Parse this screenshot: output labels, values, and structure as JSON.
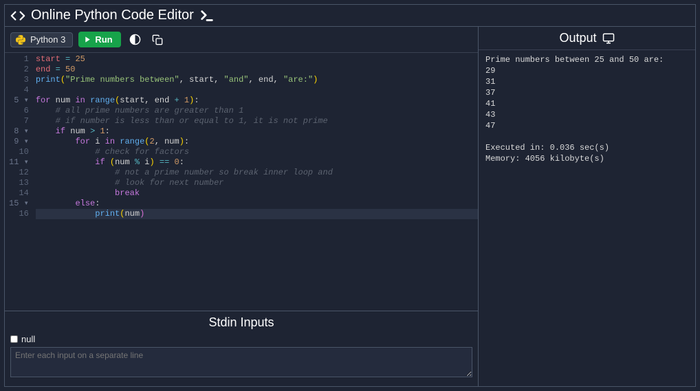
{
  "header": {
    "title": "Online Python Code Editor"
  },
  "toolbar": {
    "language": "Python 3",
    "run_label": "Run"
  },
  "editor": {
    "lines": [
      {
        "n": 1,
        "fold": false,
        "tokens": [
          {
            "t": "start",
            "c": "var"
          },
          {
            "t": " "
          },
          {
            "t": "=",
            "c": "op"
          },
          {
            "t": " "
          },
          {
            "t": "25",
            "c": "num"
          }
        ]
      },
      {
        "n": 2,
        "fold": false,
        "tokens": [
          {
            "t": "end",
            "c": "var"
          },
          {
            "t": " "
          },
          {
            "t": "=",
            "c": "op"
          },
          {
            "t": " "
          },
          {
            "t": "50",
            "c": "num"
          }
        ]
      },
      {
        "n": 3,
        "fold": false,
        "tokens": [
          {
            "t": "print",
            "c": "fn"
          },
          {
            "t": "(",
            "c": "par"
          },
          {
            "t": "\"Prime numbers between\"",
            "c": "str"
          },
          {
            "t": ", start, "
          },
          {
            "t": "\"and\"",
            "c": "str"
          },
          {
            "t": ", end, "
          },
          {
            "t": "\"are:\"",
            "c": "str"
          },
          {
            "t": ")",
            "c": "par"
          }
        ]
      },
      {
        "n": 4,
        "fold": false,
        "tokens": []
      },
      {
        "n": 5,
        "fold": true,
        "tokens": [
          {
            "t": "for",
            "c": "kw"
          },
          {
            "t": " num "
          },
          {
            "t": "in",
            "c": "kw"
          },
          {
            "t": " "
          },
          {
            "t": "range",
            "c": "fn"
          },
          {
            "t": "(",
            "c": "par"
          },
          {
            "t": "start, end "
          },
          {
            "t": "+",
            "c": "op"
          },
          {
            "t": " "
          },
          {
            "t": "1",
            "c": "num"
          },
          {
            "t": ")",
            "c": "par"
          },
          {
            "t": ":"
          }
        ]
      },
      {
        "n": 6,
        "fold": false,
        "tokens": [
          {
            "t": "    "
          },
          {
            "t": "# all prime numbers are greater than 1",
            "c": "cm"
          }
        ]
      },
      {
        "n": 7,
        "fold": false,
        "tokens": [
          {
            "t": "    "
          },
          {
            "t": "# if number is less than or equal to 1, it is not prime",
            "c": "cm"
          }
        ]
      },
      {
        "n": 8,
        "fold": true,
        "tokens": [
          {
            "t": "    "
          },
          {
            "t": "if",
            "c": "kw"
          },
          {
            "t": " num "
          },
          {
            "t": ">",
            "c": "op"
          },
          {
            "t": " "
          },
          {
            "t": "1",
            "c": "num"
          },
          {
            "t": ":"
          }
        ]
      },
      {
        "n": 9,
        "fold": true,
        "tokens": [
          {
            "t": "        "
          },
          {
            "t": "for",
            "c": "kw"
          },
          {
            "t": " i "
          },
          {
            "t": "in",
            "c": "kw"
          },
          {
            "t": " "
          },
          {
            "t": "range",
            "c": "fn"
          },
          {
            "t": "(",
            "c": "par"
          },
          {
            "t": "2",
            "c": "num"
          },
          {
            "t": ", num"
          },
          {
            "t": ")",
            "c": "par"
          },
          {
            "t": ":"
          }
        ]
      },
      {
        "n": 10,
        "fold": false,
        "tokens": [
          {
            "t": "            "
          },
          {
            "t": "# check for factors",
            "c": "cm"
          }
        ]
      },
      {
        "n": 11,
        "fold": true,
        "tokens": [
          {
            "t": "            "
          },
          {
            "t": "if",
            "c": "kw"
          },
          {
            "t": " "
          },
          {
            "t": "(",
            "c": "par"
          },
          {
            "t": "num "
          },
          {
            "t": "%",
            "c": "op"
          },
          {
            "t": " i"
          },
          {
            "t": ")",
            "c": "par"
          },
          {
            "t": " "
          },
          {
            "t": "==",
            "c": "op"
          },
          {
            "t": " "
          },
          {
            "t": "0",
            "c": "num"
          },
          {
            "t": ":"
          }
        ]
      },
      {
        "n": 12,
        "fold": false,
        "tokens": [
          {
            "t": "                "
          },
          {
            "t": "# not a prime number so break inner loop and",
            "c": "cm"
          }
        ]
      },
      {
        "n": 13,
        "fold": false,
        "tokens": [
          {
            "t": "                "
          },
          {
            "t": "# look for next number",
            "c": "cm"
          }
        ]
      },
      {
        "n": 14,
        "fold": false,
        "tokens": [
          {
            "t": "                "
          },
          {
            "t": "break",
            "c": "kw"
          }
        ]
      },
      {
        "n": 15,
        "fold": true,
        "tokens": [
          {
            "t": "        "
          },
          {
            "t": "else",
            "c": "kw"
          },
          {
            "t": ":"
          }
        ]
      },
      {
        "n": 16,
        "fold": false,
        "active": true,
        "tokens": [
          {
            "t": "            "
          },
          {
            "t": "print",
            "c": "fn"
          },
          {
            "t": "(",
            "c": "par"
          },
          {
            "t": "num"
          },
          {
            "t": ")",
            "c": "par2"
          }
        ]
      }
    ]
  },
  "stdin": {
    "title": "Stdin Inputs",
    "null_label": "null",
    "placeholder": "Enter each input on a separate line"
  },
  "output": {
    "title": "Output",
    "lines": [
      "Prime numbers between 25 and 50 are:",
      "29",
      "31",
      "37",
      "41",
      "43",
      "47"
    ],
    "exec_line": "Executed in: 0.036 sec(s)",
    "mem_line": "Memory: 4056 kilobyte(s)"
  }
}
